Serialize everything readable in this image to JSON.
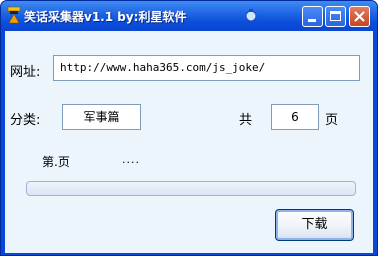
{
  "window": {
    "title": "笑话采集器v1.1  by:利星软件"
  },
  "form": {
    "url_label": "网址:",
    "url_value": "http://www.haha365.com/js_joke/",
    "category_label": "分类:",
    "category_value": "军事篇",
    "total_label": "共",
    "pages_value": "6",
    "pages_unit": "页",
    "page_status_label": "第.页",
    "page_status_dots": "....",
    "progress_fraction": 0,
    "download_button": "下载"
  },
  "colors": {
    "titlebar": "#0b4fdb",
    "client_bg": "#ecf4fc"
  }
}
